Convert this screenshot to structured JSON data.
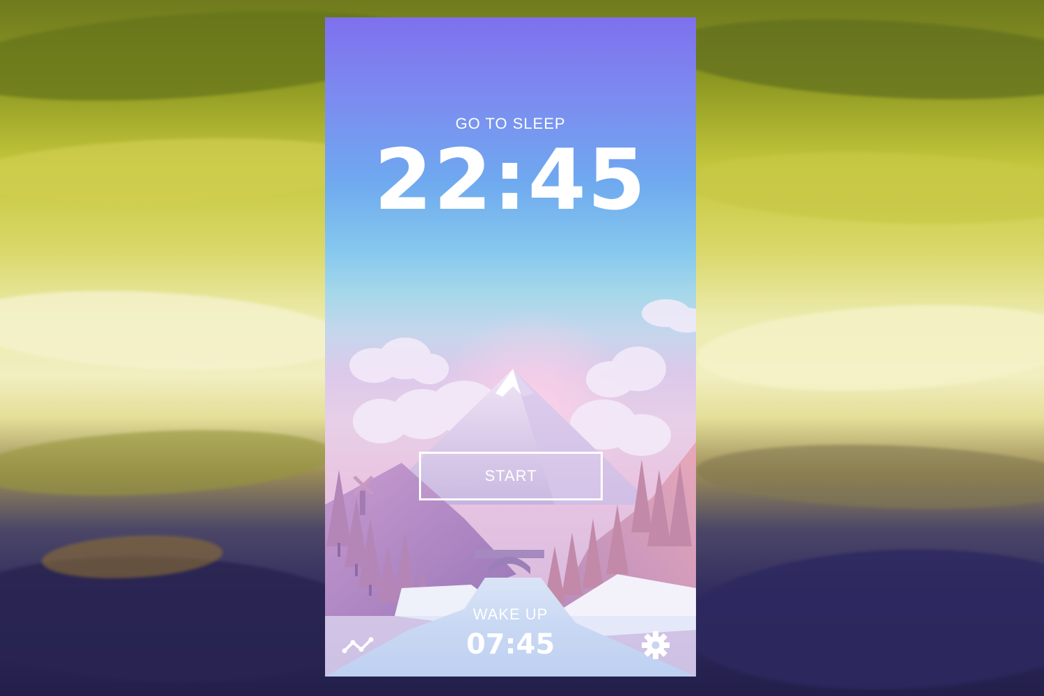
{
  "screen": {
    "sleep_label": "GO TO SLEEP",
    "sleep_time": "22:45",
    "start_label": "START",
    "wake_label": "WAKE UP",
    "wake_time": "07:45"
  },
  "icons": {
    "stats": "stats-icon",
    "settings": "gear-icon"
  },
  "colors": {
    "text": "#ffffff",
    "gradient_top": "#7f70ee",
    "gradient_mid": "#84c7ee",
    "gradient_bottom": "#e9c5e2"
  }
}
